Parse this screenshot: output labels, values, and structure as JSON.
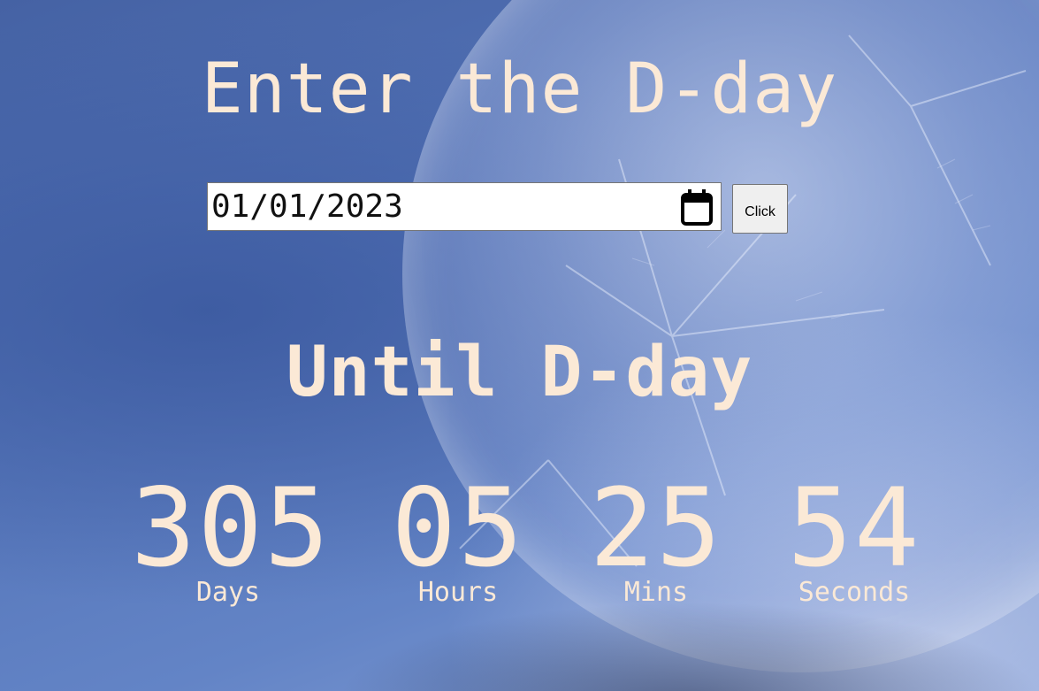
{
  "heading": "Enter the D-day",
  "date_input": {
    "value": "01/01/2023"
  },
  "button_label": "Click",
  "subheading": "Until D-day",
  "countdown": [
    {
      "value": "305",
      "label": "Days"
    },
    {
      "value": "05",
      "label": "Hours"
    },
    {
      "value": "25",
      "label": "Mins"
    },
    {
      "value": "54",
      "label": "Seconds"
    }
  ],
  "colors": {
    "text": "#fbe9d6",
    "background": "#4a6aa8"
  },
  "icons": {
    "date_picker": "calendar-icon"
  }
}
